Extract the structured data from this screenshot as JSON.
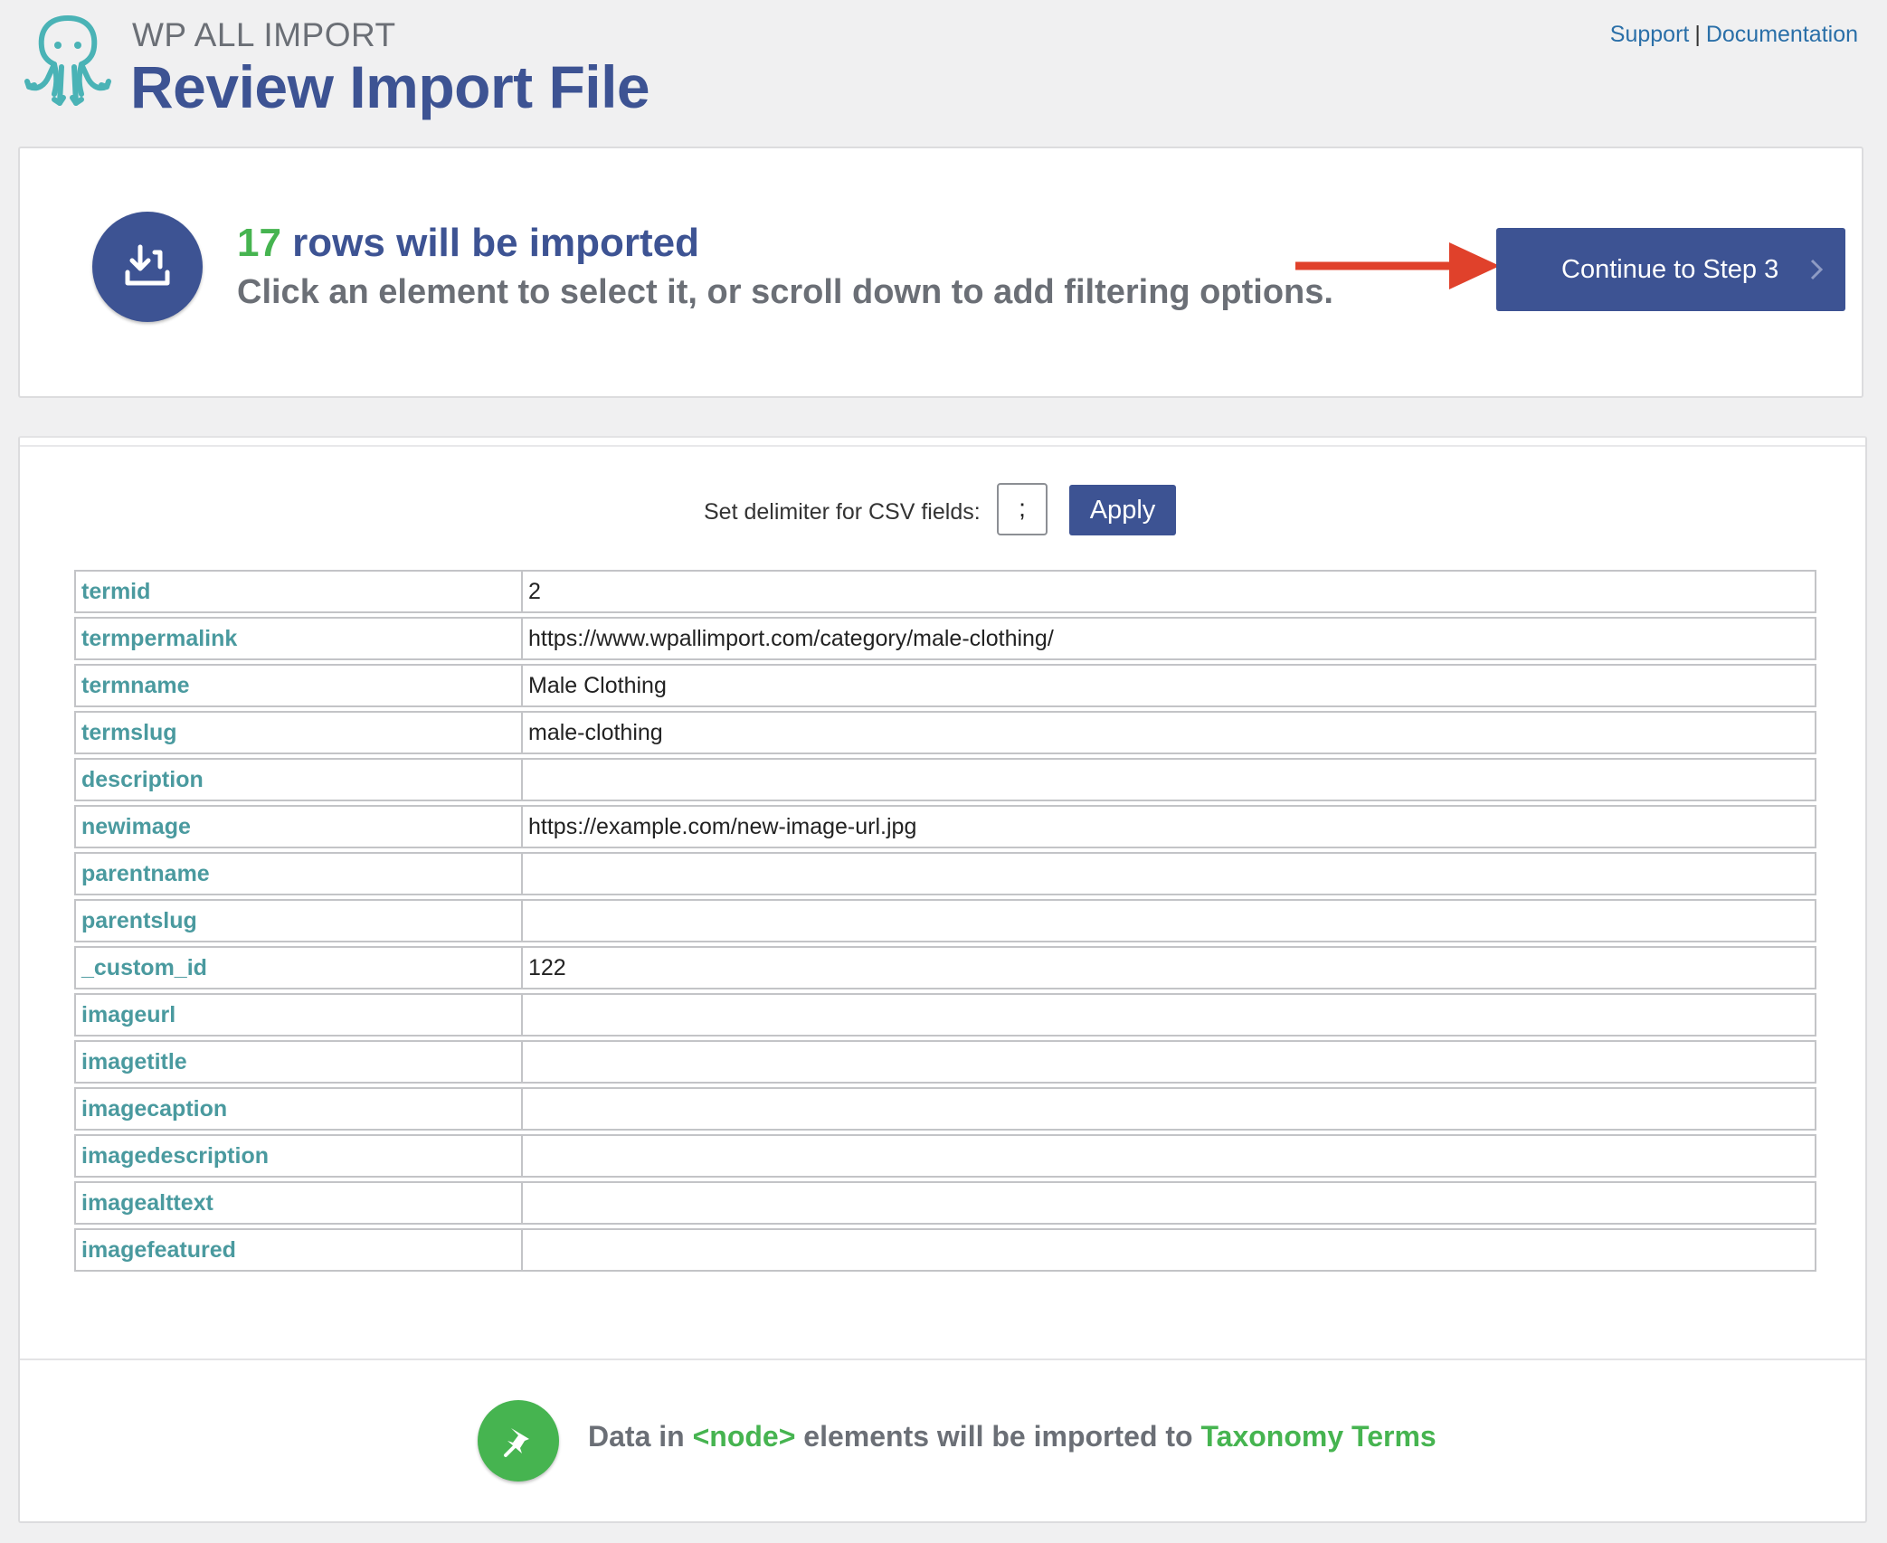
{
  "header": {
    "brand": "WP ALL IMPORT",
    "title": "Review Import File",
    "links": {
      "support": "Support",
      "separator": "|",
      "documentation": "Documentation"
    }
  },
  "summary": {
    "row_count": "17",
    "headline_rest": " rows will be imported",
    "instruction": "Click an element to select it, or scroll down to add filtering options.",
    "continue_label": "Continue to Step 3",
    "icon": "import-icon"
  },
  "delimiter": {
    "label": "Set delimiter for CSV fields:",
    "value": ";",
    "apply_label": "Apply"
  },
  "rows": [
    {
      "key": "termid",
      "value": "2"
    },
    {
      "key": "termpermalink",
      "value": "https://www.wpallimport.com/category/male-clothing/"
    },
    {
      "key": "termname",
      "value": "Male Clothing"
    },
    {
      "key": "termslug",
      "value": "male-clothing"
    },
    {
      "key": "description",
      "value": ""
    },
    {
      "key": "newimage",
      "value": "https://example.com/new-image-url.jpg"
    },
    {
      "key": "parentname",
      "value": ""
    },
    {
      "key": "parentslug",
      "value": ""
    },
    {
      "key": "_custom_id",
      "value": "122"
    },
    {
      "key": "imageurl",
      "value": ""
    },
    {
      "key": "imagetitle",
      "value": ""
    },
    {
      "key": "imagecaption",
      "value": ""
    },
    {
      "key": "imagedescription",
      "value": ""
    },
    {
      "key": "imagealttext",
      "value": ""
    },
    {
      "key": "imagefeatured",
      "value": ""
    }
  ],
  "footer": {
    "prefix": "Data in ",
    "node": "<node>",
    "middle": " elements will be imported to ",
    "target": "Taxonomy Terms",
    "icon": "pin-icon"
  },
  "colors": {
    "brand_blue": "#3d5393",
    "green": "#46b450",
    "teal_key": "#4a9a9f",
    "arrow_red": "#e0412b"
  }
}
